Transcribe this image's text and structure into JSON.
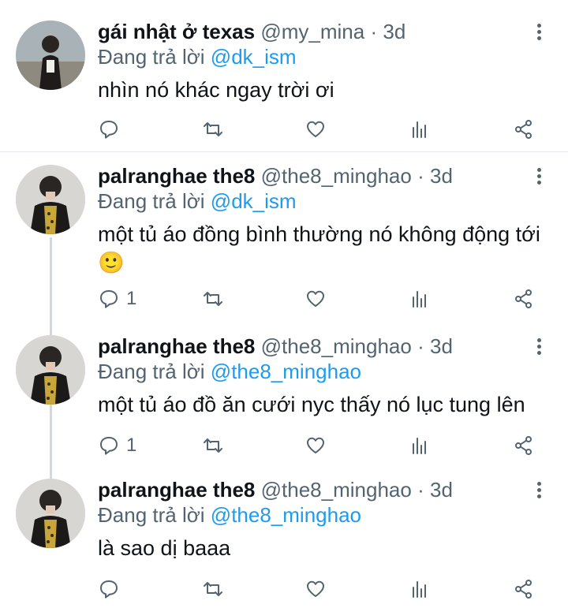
{
  "reply_prefix": "Đang trả lời",
  "tweets": [
    {
      "display_name": "gái nhật ở texas",
      "handle": "@my_mina",
      "time": "3d",
      "reply_to": "@dk_ism",
      "text": "nhìn nó khác ngay trời ơi",
      "reply_count": "",
      "avatar_icon": "avatar-girl-photo"
    },
    {
      "display_name": "palranghae the8",
      "handle": "@the8_minghao",
      "time": "3d",
      "reply_to": "@dk_ism",
      "text": "một tủ áo đồng bình thường nó không động tới",
      "emoji": "🙂",
      "reply_count": "1",
      "avatar_icon": "avatar-man-photo"
    },
    {
      "display_name": "palranghae the8",
      "handle": "@the8_minghao",
      "time": "3d",
      "reply_to": "@the8_minghao",
      "text": "một tủ áo đồ ăn cưới nyc thấy nó lục tung lên",
      "reply_count": "1",
      "avatar_icon": "avatar-man-photo"
    },
    {
      "display_name": "palranghae the8",
      "handle": "@the8_minghao",
      "time": "3d",
      "reply_to": "@the8_minghao",
      "text": "là sao dị baaa",
      "reply_count": "",
      "avatar_icon": "avatar-man-photo"
    }
  ],
  "colors": {
    "accent": "#1d9bf0",
    "secondary_text": "#536471",
    "thread_line": "#cfd9de"
  }
}
